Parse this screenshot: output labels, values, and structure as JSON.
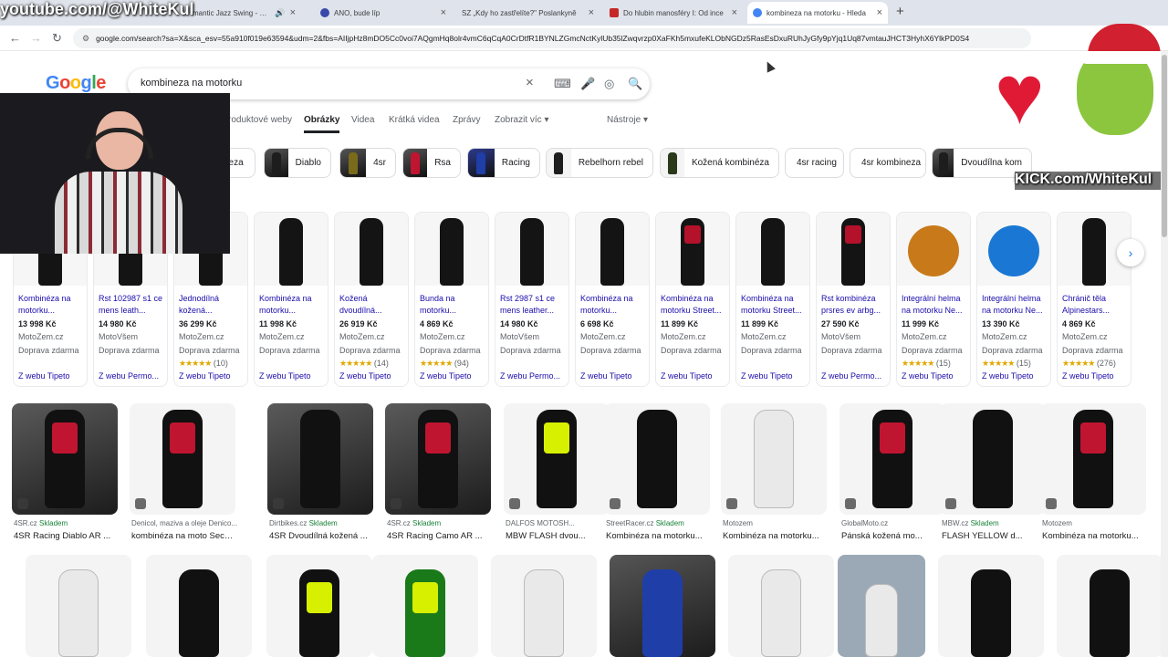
{
  "browser": {
    "tabs": [
      {
        "title": "mantic Jazz Swing - 193\u0010",
        "favicon_color": "#e53935"
      },
      {
        "title": "ANO, bude líp",
        "favicon_color": "#3949ab"
      },
      {
        "title": "SZ  „Kdy ho zastřelíte?\" Poslankyně",
        "favicon_color": "#222222"
      },
      {
        "title": "Do hlubin manosféry I: Od ince",
        "favicon_color": "#c62828"
      },
      {
        "title": "kombineza na motorku - Hleda",
        "favicon_color": "#4285f4"
      }
    ],
    "new_tab_label": "+",
    "url": "google.com/search?sa=X&sca_esv=55a910f019e63594&udm=2&fbs=AIIjpHz8mDO5Cc0voi7AQgmHq8olr4vmC6qCqA0CrDtfR1BYNLZGmcNctKylUb35lZwqvrzp0XaFKh5mxufeKLObNGDz5RasEsDxuRUhJyGfy9pYjq1Uq87vmtauJHCT3HyhX6YlkPD0S4"
  },
  "google": {
    "logo": "Google",
    "query": "kombineza na motorku",
    "tabs": [
      "roduktové weby",
      "Obrázky",
      "Videa",
      "Krátká videa",
      "Zprávy",
      "Zobrazit víc ▾"
    ],
    "tools": "Nástroje ▾",
    "chips": [
      "neza",
      "Diablo",
      "4sr",
      "Rsa",
      "Racing",
      "Rebelhorn rebel",
      "Kožená kombinéza",
      "4sr racing",
      "4sr kombineza",
      "Dvoudílna kom"
    ]
  },
  "products": [
    {
      "title": "Kombinéza na motorku...",
      "price": "13 998 Kč",
      "store": "MotoZem.cz",
      "ship": "Doprava zdarma",
      "rating": "",
      "reviews": "",
      "web": "Z webu Tipeto"
    },
    {
      "title": "Rst 102987 s1 ce mens leath...",
      "price": "14 980 Kč",
      "store": "MotoVšem",
      "ship": "Doprava zdarma",
      "rating": "",
      "reviews": "",
      "web": "Z webu Permo..."
    },
    {
      "title": "Jednodílná kožená...",
      "price": "36 299 Kč",
      "store": "MotoZem.cz",
      "ship": "Doprava zdarma",
      "rating": "★★★★★",
      "reviews": "(10)",
      "web": "Z webu Tipeto"
    },
    {
      "title": "Kombinéza na motorku...",
      "price": "11 998 Kč",
      "store": "MotoZem.cz",
      "ship": "Doprava zdarma",
      "rating": "",
      "reviews": "",
      "web": "Z webu Tipeto"
    },
    {
      "title": "Kožená dvoudílná...",
      "price": "26 919 Kč",
      "store": "MotoZem.cz",
      "ship": "Doprava zdarma",
      "rating": "★★★★★",
      "reviews": "(14)",
      "web": "Z webu Tipeto"
    },
    {
      "title": "Bunda na motorku...",
      "price": "4 869 Kč",
      "store": "MotoZem.cz",
      "ship": "Doprava zdarma",
      "rating": "★★★★★",
      "reviews": "(94)",
      "web": "Z webu Tipeto"
    },
    {
      "title": "Rst 2987 s1 ce mens leather...",
      "price": "14 980 Kč",
      "store": "MotoVšem",
      "ship": "Doprava zdarma",
      "rating": "",
      "reviews": "",
      "web": "Z webu Permo..."
    },
    {
      "title": "Kombinéza na motorku...",
      "price": "6 698 Kč",
      "store": "MotoZem.cz",
      "ship": "Doprava zdarma",
      "rating": "",
      "reviews": "",
      "web": "Z webu Tipeto"
    },
    {
      "title": "Kombinéza na motorku Street...",
      "price": "11 899 Kč",
      "store": "MotoZem.cz",
      "ship": "Doprava zdarma",
      "rating": "",
      "reviews": "",
      "web": "Z webu Tipeto"
    },
    {
      "title": "Kombinéza na motorku Street...",
      "price": "11 899 Kč",
      "store": "MotoZem.cz",
      "ship": "Doprava zdarma",
      "rating": "",
      "reviews": "",
      "web": "Z webu Tipeto"
    },
    {
      "title": "Rst kombinéza prsres ev arbg...",
      "price": "27 590 Kč",
      "store": "MotoVšem",
      "ship": "Doprava zdarma",
      "rating": "",
      "reviews": "",
      "web": "Z webu Permo..."
    },
    {
      "title": "Integrální helma na motorku Ne...",
      "price": "11 999 Kč",
      "store": "MotoZem.cz",
      "ship": "Doprava zdarma",
      "rating": "★★★★★",
      "reviews": "(15)",
      "web": "Z webu Tipeto"
    },
    {
      "title": "Integrální helma na motorku Ne...",
      "price": "13 390 Kč",
      "store": "MotoZem.cz",
      "ship": "Doprava zdarma",
      "rating": "★★★★★",
      "reviews": "(15)",
      "web": "Z webu Tipeto"
    },
    {
      "title": "Chránič těla Alpinestars...",
      "price": "4 869 Kč",
      "store": "MotoZem.cz",
      "ship": "Doprava zdarma",
      "rating": "★★★★★",
      "reviews": "(276)",
      "web": "Z webu Tipeto"
    }
  ],
  "images": [
    {
      "source": "4SR.cz",
      "stock": "Skladem",
      "title": "4SR Racing Diablo AR ..."
    },
    {
      "source": "Denicol, maziva a oleje Denico...",
      "stock": "",
      "title": "kombinéza na moto Seca S..."
    },
    {
      "source": "Dirtbikes.cz",
      "stock": "Skladem",
      "title": "4SR Dvoudílná kožená ..."
    },
    {
      "source": "4SR.cz",
      "stock": "Skladem",
      "title": "4SR Racing Camo AR ..."
    },
    {
      "source": "DALFOS MOTOSH...",
      "stock": "",
      "title": "MBW FLASH dvou..."
    },
    {
      "source": "StreetRacer.cz",
      "stock": "Skladem",
      "title": "Kombinéza na motorku..."
    },
    {
      "source": "Motozem",
      "stock": "",
      "title": "Kombinéza na motorku..."
    },
    {
      "source": "GlobalMoto.cz",
      "stock": "",
      "title": "Pánská kožená mo..."
    },
    {
      "source": "MBW.cz",
      "stock": "Skladem",
      "title": "FLASH YELLOW d..."
    },
    {
      "source": "Motozem",
      "stock": "",
      "title": "Kombinéza na motorku..."
    }
  ],
  "overlays": {
    "watermark_top": "youtube.com/@WhiteKul",
    "watermark_kick": "KICK.com/WhiteKul"
  },
  "colors": {
    "link": "#1a0dab",
    "accent": "#1a73e8",
    "stock": "#188038",
    "star": "#e0a800"
  }
}
